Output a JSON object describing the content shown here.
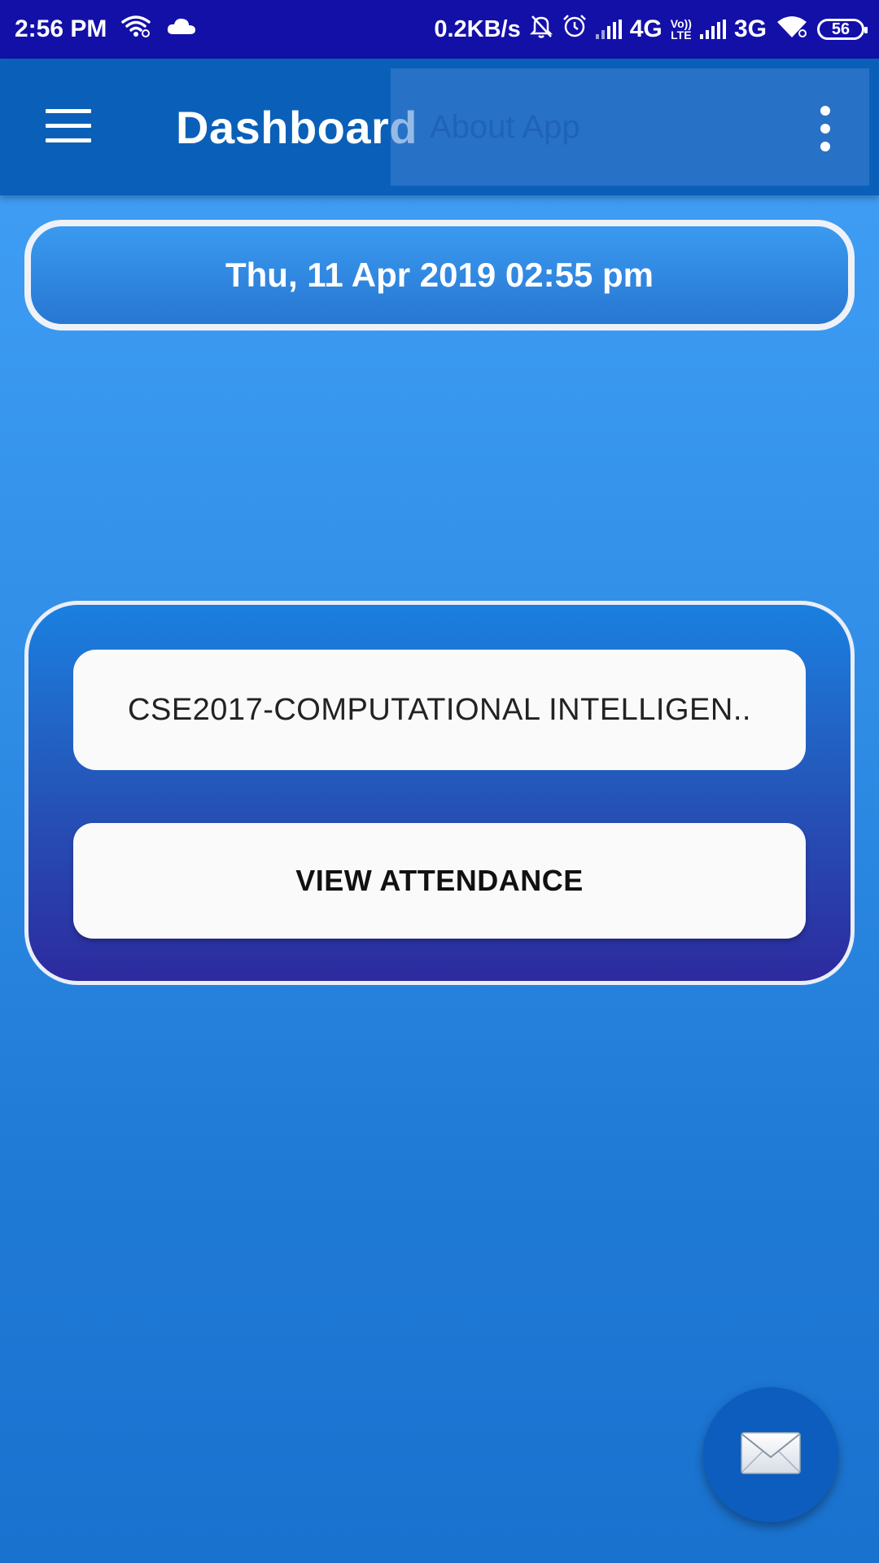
{
  "status_bar": {
    "time": "2:56 PM",
    "net_speed": "0.2KB/s",
    "network_1": "4G",
    "volte": [
      "Vo))",
      "LTE"
    ],
    "network_2": "3G",
    "battery": "56"
  },
  "app_bar": {
    "title": "Dashboard",
    "menu_item": "About App"
  },
  "date_time": "Thu, 11 Apr 2019 02:55 pm",
  "course": {
    "name": "CSE2017-COMPUTATIONAL INTELLIGEN..",
    "button_label": "VIEW ATTENDANCE"
  },
  "icons": {
    "status_left": [
      "wifi-link-icon",
      "cloud-icon"
    ],
    "status_right": [
      "bell-off-icon",
      "alarm-icon",
      "signal-icon",
      "signal-icon",
      "wifi-icon",
      "battery-icon"
    ],
    "app_bar": [
      "menu-icon",
      "more-vert-icon"
    ],
    "fab": "mail-icon"
  }
}
